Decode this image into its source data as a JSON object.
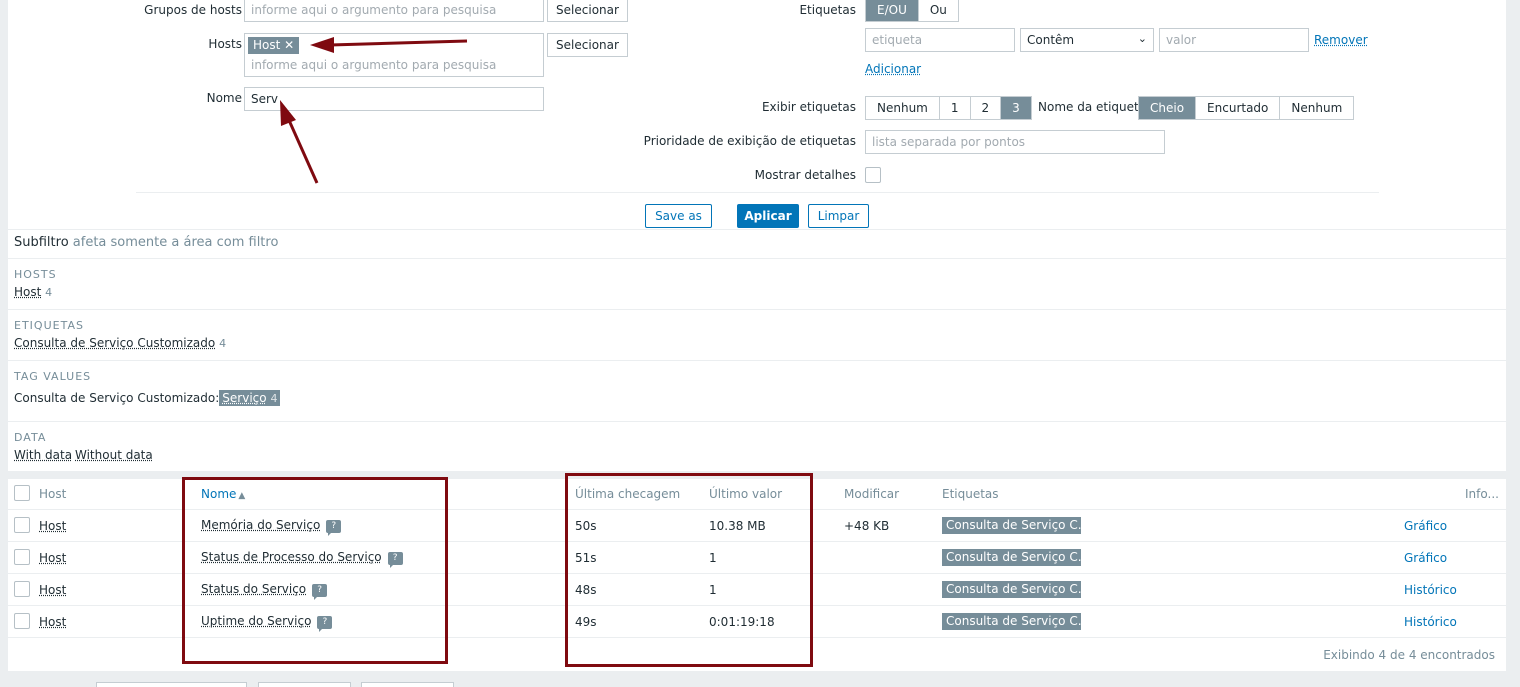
{
  "filter": {
    "host_groups_label": "Grupos de hosts",
    "host_groups_placeholder": "informe aqui o argumento para pesquisa",
    "select_label": "Selecionar",
    "hosts_label": "Hosts",
    "hosts_chip": "Host",
    "hosts_placeholder": "informe aqui o argumento para pesquisa",
    "name_label": "Nome",
    "name_value": "Serv",
    "tags_label": "Etiquetas",
    "tags_op_and": "E/OU",
    "tags_op_or": "Ou",
    "tag_placeholder": "etiqueta",
    "tag_operator": "Contêm",
    "value_placeholder": "valor",
    "remove_label": "Remover",
    "add_label": "Adicionar",
    "show_tags_label": "Exibir etiquetas",
    "show_tags_options": [
      "Nenhum",
      "1",
      "2",
      "3"
    ],
    "tag_name_label": "Nome da etiqueta",
    "tag_name_options": [
      "Cheio",
      "Encurtado",
      "Nenhum"
    ],
    "tag_priority_label": "Prioridade de exibição de etiquetas",
    "tag_priority_placeholder": "lista separada por pontos",
    "show_details_label": "Mostrar detalhes",
    "save_as": "Save as",
    "apply": "Aplicar",
    "reset": "Limpar"
  },
  "subfilter": {
    "title": "Subfiltro",
    "hint": "afeta somente a área com filtro",
    "hosts_title": "HOSTS",
    "host_item": "Host",
    "host_count": "4",
    "tags_title": "ETIQUETAS",
    "tag_item": "Consulta de Serviço Customizado",
    "tag_count": "4",
    "tag_values_title": "TAG VALUES",
    "tag_value_prefix": "Consulta de Serviço Customizado:",
    "tag_value_item": "Serviço",
    "tag_value_count": "4",
    "data_title": "DATA",
    "with_data": "With data",
    "without_data": "Without data"
  },
  "table": {
    "headers": {
      "host": "Host",
      "name": "Nome",
      "sort_icon": "▲",
      "last_check": "Última checagem",
      "last_value": "Último valor",
      "change": "Modificar",
      "tags": "Etiquetas",
      "info": "Info..."
    },
    "rows": [
      {
        "host": "Host",
        "name": "Memória do Serviço",
        "last_check": "50s",
        "last_value": "10.38 MB",
        "change": "+48 KB",
        "tag": "Consulta de Serviço C...",
        "action": "Gráfico"
      },
      {
        "host": "Host",
        "name": "Status de Processo do Serviço",
        "last_check": "51s",
        "last_value": "1",
        "change": "",
        "tag": "Consulta de Serviço C...",
        "action": "Gráfico"
      },
      {
        "host": "Host",
        "name": "Status do Serviço",
        "last_check": "48s",
        "last_value": "1",
        "change": "",
        "tag": "Consulta de Serviço C...",
        "action": "Histórico"
      },
      {
        "host": "Host",
        "name": "Uptime do Serviço",
        "last_check": "49s",
        "last_value": "0:01:19:18",
        "change": "",
        "tag": "Consulta de Serviço C...",
        "action": "Histórico"
      }
    ],
    "help_icon": "?",
    "footer": "Exibindo 4 de 4 encontrados"
  },
  "colors": {
    "accent": "#0275b8",
    "badge": "#768d99",
    "annotation": "#7f0a10"
  }
}
